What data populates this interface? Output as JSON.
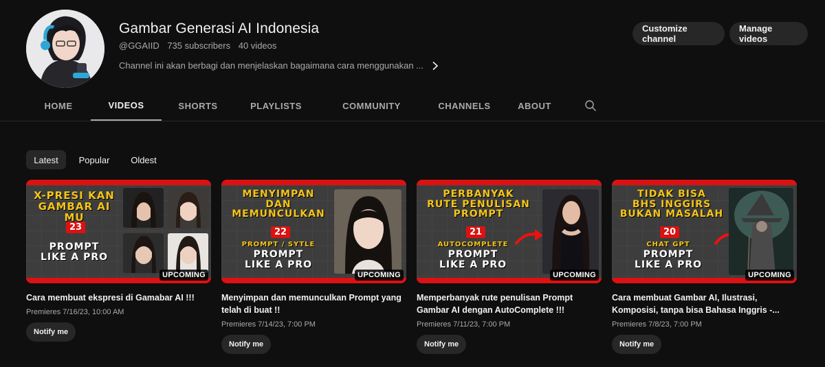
{
  "channel": {
    "title": "Gambar Generasi AI Indonesia",
    "handle": "@GGAIID",
    "subscribers": "735 subscribers",
    "videos": "40 videos",
    "description": "Channel ini akan berbagi dan menjelaskan bagaimana cara menggunakan ..."
  },
  "actions": {
    "customize": "Customize channel",
    "manage": "Manage videos"
  },
  "tabs": [
    "HOME",
    "VIDEOS",
    "SHORTS",
    "PLAYLISTS",
    "COMMUNITY",
    "CHANNELS",
    "ABOUT"
  ],
  "active_tab": "VIDEOS",
  "filters": [
    "Latest",
    "Popular",
    "Oldest"
  ],
  "active_filter": "Latest",
  "videos": [
    {
      "thumb_line1": "X-PRESI KAN",
      "thumb_line2": "GAMBAR AI MU",
      "thumb_number": "23",
      "thumb_line3": "PROMPT",
      "thumb_line4": "LIKE A PRO",
      "badge": "UPCOMING",
      "title": "Cara membuat ekspresi di Gamabar AI !!!",
      "meta": "Premieres 7/16/23, 10:00 AM",
      "notify": "Notify me"
    },
    {
      "thumb_line1": "MENYIMPAN",
      "thumb_line1b": "DAN",
      "thumb_line2": "MEMUNCULKAN",
      "thumb_number": "22",
      "thumb_sub": "PROMPT / SYTLE",
      "thumb_line3": "PROMPT",
      "thumb_line4": "LIKE A PRO",
      "badge": "UPCOMING",
      "title": "Menyimpan dan memunculkan Prompt yang telah di buat !!",
      "meta": "Premieres 7/14/23, 7:00 PM",
      "notify": "Notify me"
    },
    {
      "thumb_line1": "PERBANYAK",
      "thumb_line1b": "RUTE PENULISAN",
      "thumb_line2": "PROMPT",
      "thumb_number": "21",
      "thumb_sub": "AUTOCOMPLETE",
      "thumb_line3": "PROMPT",
      "thumb_line4": "LIKE A PRO",
      "badge": "UPCOMING",
      "title": "Memperbanyak rute penulisan Prompt Gambar AI dengan AutoComplete !!!",
      "meta": "Premieres 7/11/23, 7:00 PM",
      "notify": "Notify me"
    },
    {
      "thumb_line1": "TIDAK BISA",
      "thumb_line1b": "BHS INGGIRS",
      "thumb_line2": "BUKAN MASALAH",
      "thumb_number": "20",
      "thumb_sub": "CHAT GPT",
      "thumb_line3": "PROMPT",
      "thumb_line4": "LIKE A PRO",
      "badge": "UPCOMING",
      "title": "Cara membuat Gambar AI, Ilustrasi, Komposisi, tanpa bisa Bahasa Inggris -...",
      "meta": "Premieres 7/8/23, 7:00 PM",
      "notify": "Notify me"
    }
  ],
  "colors": {
    "background": "#0f0f0f",
    "button_bg": "#272727",
    "thumb_accent": "#dd1111",
    "thumb_yellow": "#f5c518"
  },
  "icons": [
    "chevron-right-icon",
    "search-icon",
    "arrow-right-icon"
  ]
}
